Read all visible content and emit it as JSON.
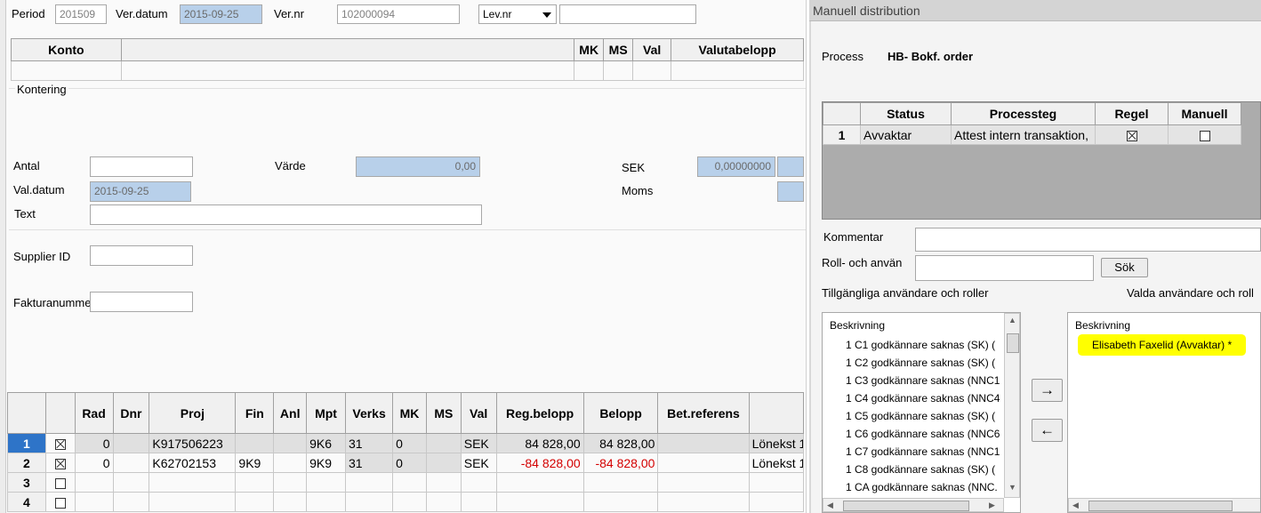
{
  "header": {
    "period_label": "Period",
    "period_value": "201509",
    "verdatum_label": "Ver.datum",
    "verdatum_value": "2015-09-25",
    "vernr_label": "Ver.nr",
    "vernr_value": "102000094",
    "levnr_select": "Lev.nr",
    "levnr_value": ""
  },
  "konto_table": {
    "headers": [
      "Konto",
      "",
      "MK",
      "MS",
      "Val",
      "Valutabelopp"
    ]
  },
  "kontering": {
    "section_label": "Kontering",
    "antal_label": "Antal",
    "antal_value": "",
    "varde_label": "Värde",
    "varde_value": "0,00",
    "sek_label": "SEK",
    "sek_value": "0,00000000",
    "valdatum_label": "Val.datum",
    "valdatum_value": "2015-09-25",
    "moms_label": "Moms",
    "text_label": "Text",
    "text_value": ""
  },
  "supplier": {
    "supplier_label": "Supplier ID",
    "faktura_label": "Fakturanumme"
  },
  "rows_table": {
    "headers": [
      "",
      "",
      "Rad",
      "Dnr",
      "Proj",
      "Fin",
      "Anl",
      "Mpt",
      "Verks",
      "MK",
      "MS",
      "Val",
      "Reg.belopp",
      "Belopp",
      "Bet.referens",
      ""
    ],
    "rows": [
      {
        "num": "1",
        "rad": "0",
        "dnr": "",
        "proj": "K917506223",
        "fin": "",
        "anl": "",
        "mpt": "9K6",
        "verks": "31",
        "mk": "0",
        "ms": "",
        "val": "SEK",
        "reg": "84 828,00",
        "belopp": "84 828,00",
        "betref": "",
        "text": "Lönekst 1"
      },
      {
        "num": "2",
        "rad": "0",
        "dnr": "",
        "proj": "K62702153",
        "fin": "9K9",
        "anl": "",
        "mpt": "9K9",
        "verks": "31",
        "mk": "0",
        "ms": "",
        "val": "SEK",
        "reg": "-84 828,00",
        "belopp": "-84 828,00",
        "betref": "",
        "text": "Lönekst 1"
      },
      {
        "num": "3"
      },
      {
        "num": "4"
      }
    ]
  },
  "distribution": {
    "title": "Manuell distribution",
    "process_label": "Process",
    "process_value": "HB- Bokf. order",
    "status_headers": [
      "",
      "Status",
      "Processteg",
      "Regel",
      "Manuell"
    ],
    "status_row": {
      "num": "1",
      "status": "Avvaktar",
      "processteg": "Attest intern transaktion,"
    },
    "kommentar_label": "Kommentar",
    "roll_label": "Roll- och använ",
    "sok_button": "Sök",
    "available_label": "Tillgängliga användare och roller",
    "selected_label": "Valda användare och roll",
    "list_header": "Beskrivning",
    "available_items": [
      "1 C1 godkännare saknas (SK) (",
      "1 C2 godkännare saknas (SK) (",
      "1 C3 godkännare saknas (NNC1",
      "1 C4 godkännare saknas (NNC4",
      "1 C5 godkännare saknas (SK) (",
      "1 C6 godkännare saknas (NNC6",
      "1 C7 godkännare saknas (NNC1",
      "1 C8 godkännare saknas (SK) (",
      "1 CA godkännare saknas (NNC."
    ],
    "selected_header": "Beskrivning",
    "selected_items": [
      "Elisabeth Faxelid (Avvaktar) *"
    ],
    "arrow_right": "→",
    "arrow_left": "←",
    "highlight_color": "#ffff00"
  }
}
